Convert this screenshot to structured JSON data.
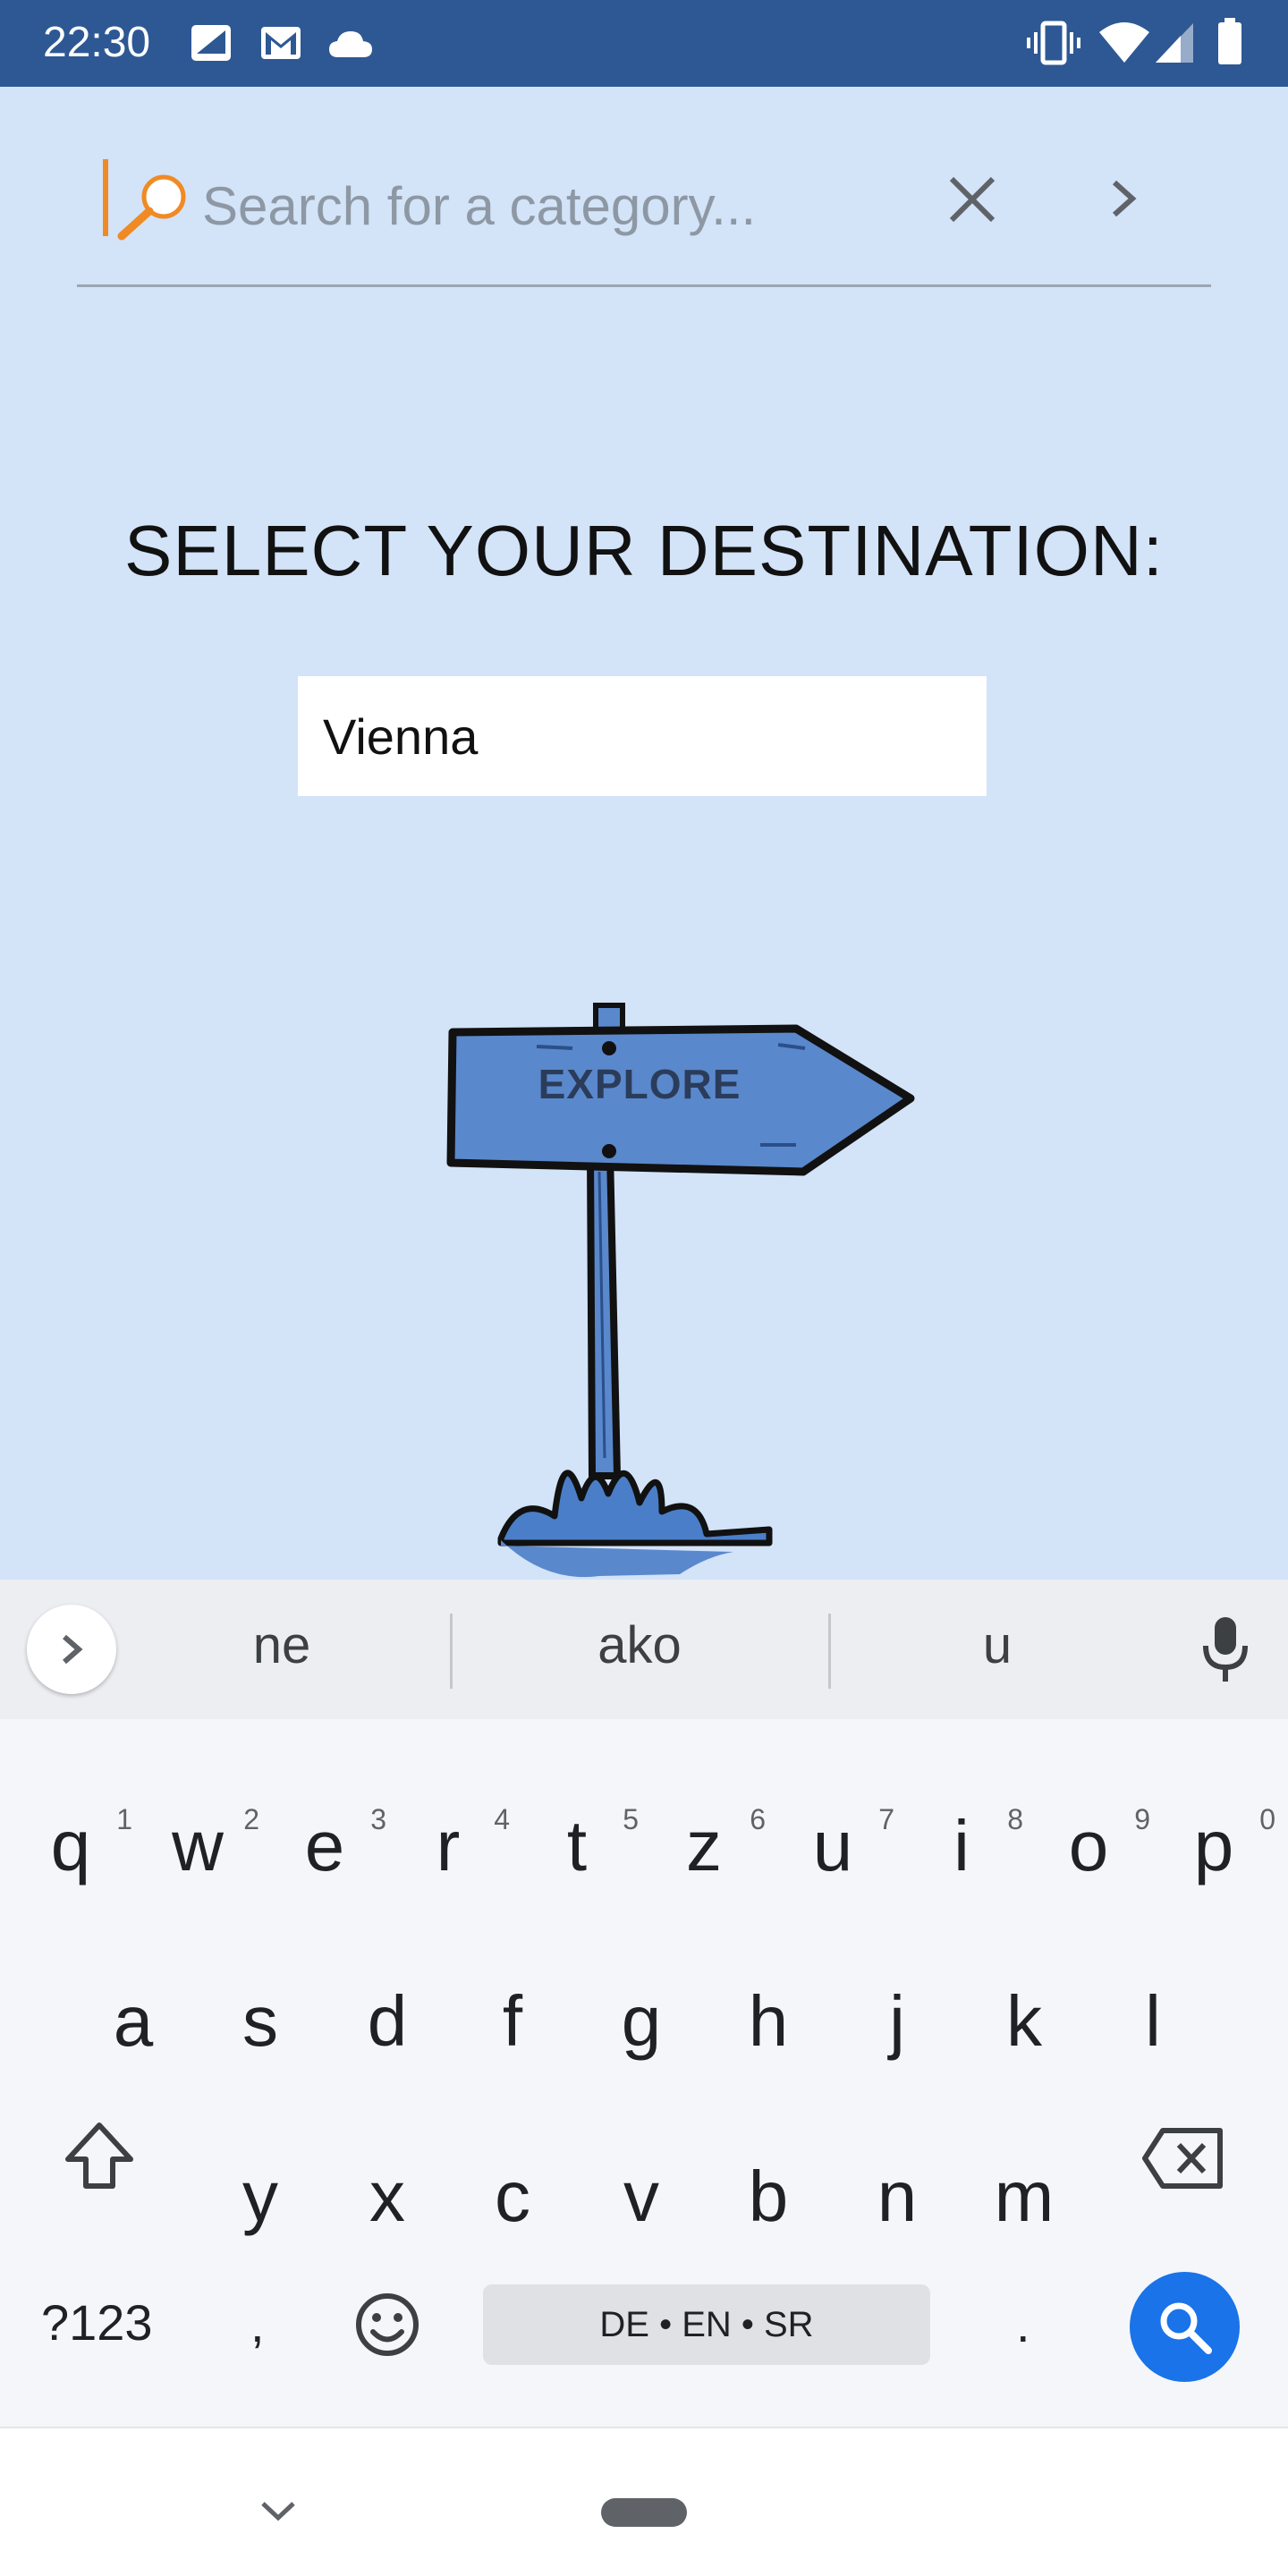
{
  "status_bar": {
    "time": "22:30",
    "left_icons": [
      "image-icon",
      "gmail-icon",
      "cloud-icon"
    ],
    "right_icons": [
      "vibrate-icon",
      "wifi-icon",
      "signal-icon",
      "battery-icon"
    ],
    "background": "#2d5894"
  },
  "search": {
    "placeholder": "Search for a category...",
    "clear_icon": "close-icon",
    "go_icon": "chevron-right-icon",
    "accent_color": "#f08a24"
  },
  "main": {
    "title": "SELECT YOUR DESTINATION:",
    "destination_value": "Vienna",
    "explore_label": "EXPLORE"
  },
  "keyboard": {
    "suggestions": [
      "ne",
      "ako",
      "u"
    ],
    "row1": [
      {
        "key": "q",
        "hint": "1"
      },
      {
        "key": "w",
        "hint": "2"
      },
      {
        "key": "e",
        "hint": "3"
      },
      {
        "key": "r",
        "hint": "4"
      },
      {
        "key": "t",
        "hint": "5"
      },
      {
        "key": "z",
        "hint": "6"
      },
      {
        "key": "u",
        "hint": "7"
      },
      {
        "key": "i",
        "hint": "8"
      },
      {
        "key": "o",
        "hint": "9"
      },
      {
        "key": "p",
        "hint": "0"
      }
    ],
    "row2": [
      "a",
      "s",
      "d",
      "f",
      "g",
      "h",
      "j",
      "k",
      "l"
    ],
    "row3": [
      "y",
      "x",
      "c",
      "v",
      "b",
      "n",
      "m"
    ],
    "symbols_label": "?123",
    "comma_label": ",",
    "period_label": ".",
    "language_label": "DE • EN • SR",
    "action_color": "#1a73e8"
  }
}
